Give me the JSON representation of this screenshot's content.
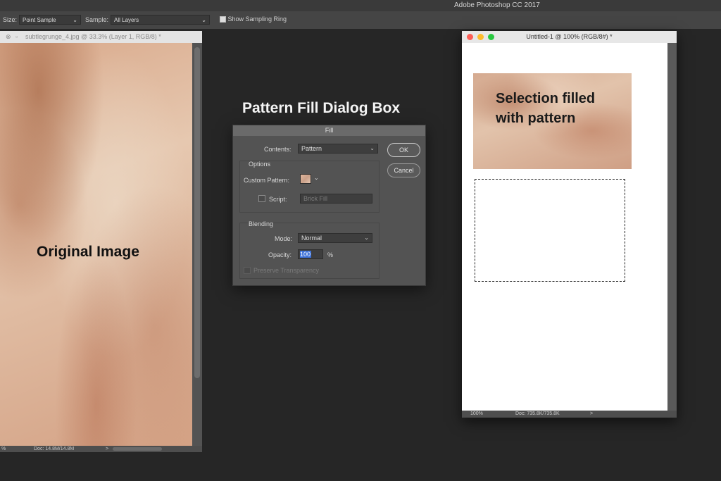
{
  "app": {
    "title": "Adobe Photoshop CC 2017"
  },
  "options_bar": {
    "size_label": "Size:",
    "size_value": "Point Sample",
    "sample_label": "Sample:",
    "sample_value": "All Layers",
    "show_ring_label": "Show Sampling Ring"
  },
  "left_doc": {
    "tab_title": "subtlegrunge_4.jpg @ 33.3% (Layer 1, RGB/8) *",
    "status_zoom": "%",
    "status_doc": "Doc: 14.8M/14.8M",
    "status_arrow": ">"
  },
  "annotations": {
    "original": "Original Image",
    "dialog_caption": "Pattern Fill Dialog Box",
    "selection_line1": "Selection filled",
    "selection_line2": "with pattern"
  },
  "dialog": {
    "title": "Fill",
    "contents_label": "Contents:",
    "contents_value": "Pattern",
    "ok_label": "OK",
    "cancel_label": "Cancel",
    "options_label": "Options",
    "custom_pattern_label": "Custom Pattern:",
    "script_label": "Script:",
    "script_value": "Brick Fill",
    "blending_label": "Blending",
    "mode_label": "Mode:",
    "mode_value": "Normal",
    "opacity_label": "Opacity:",
    "opacity_value": "100",
    "opacity_unit": "%",
    "preserve_label": "Preserve Transparency"
  },
  "right_doc": {
    "title": "Untitled-1 @ 100% (RGB/8#) *",
    "status_zoom": "100%",
    "status_doc": "Doc: 735.8K/735.8K",
    "status_arrow": ">"
  },
  "colors": {
    "traffic_close": "#fc5f57",
    "traffic_min": "#fdbc2e",
    "traffic_max": "#29c840",
    "opacity_highlight": "#3a6fd8"
  }
}
